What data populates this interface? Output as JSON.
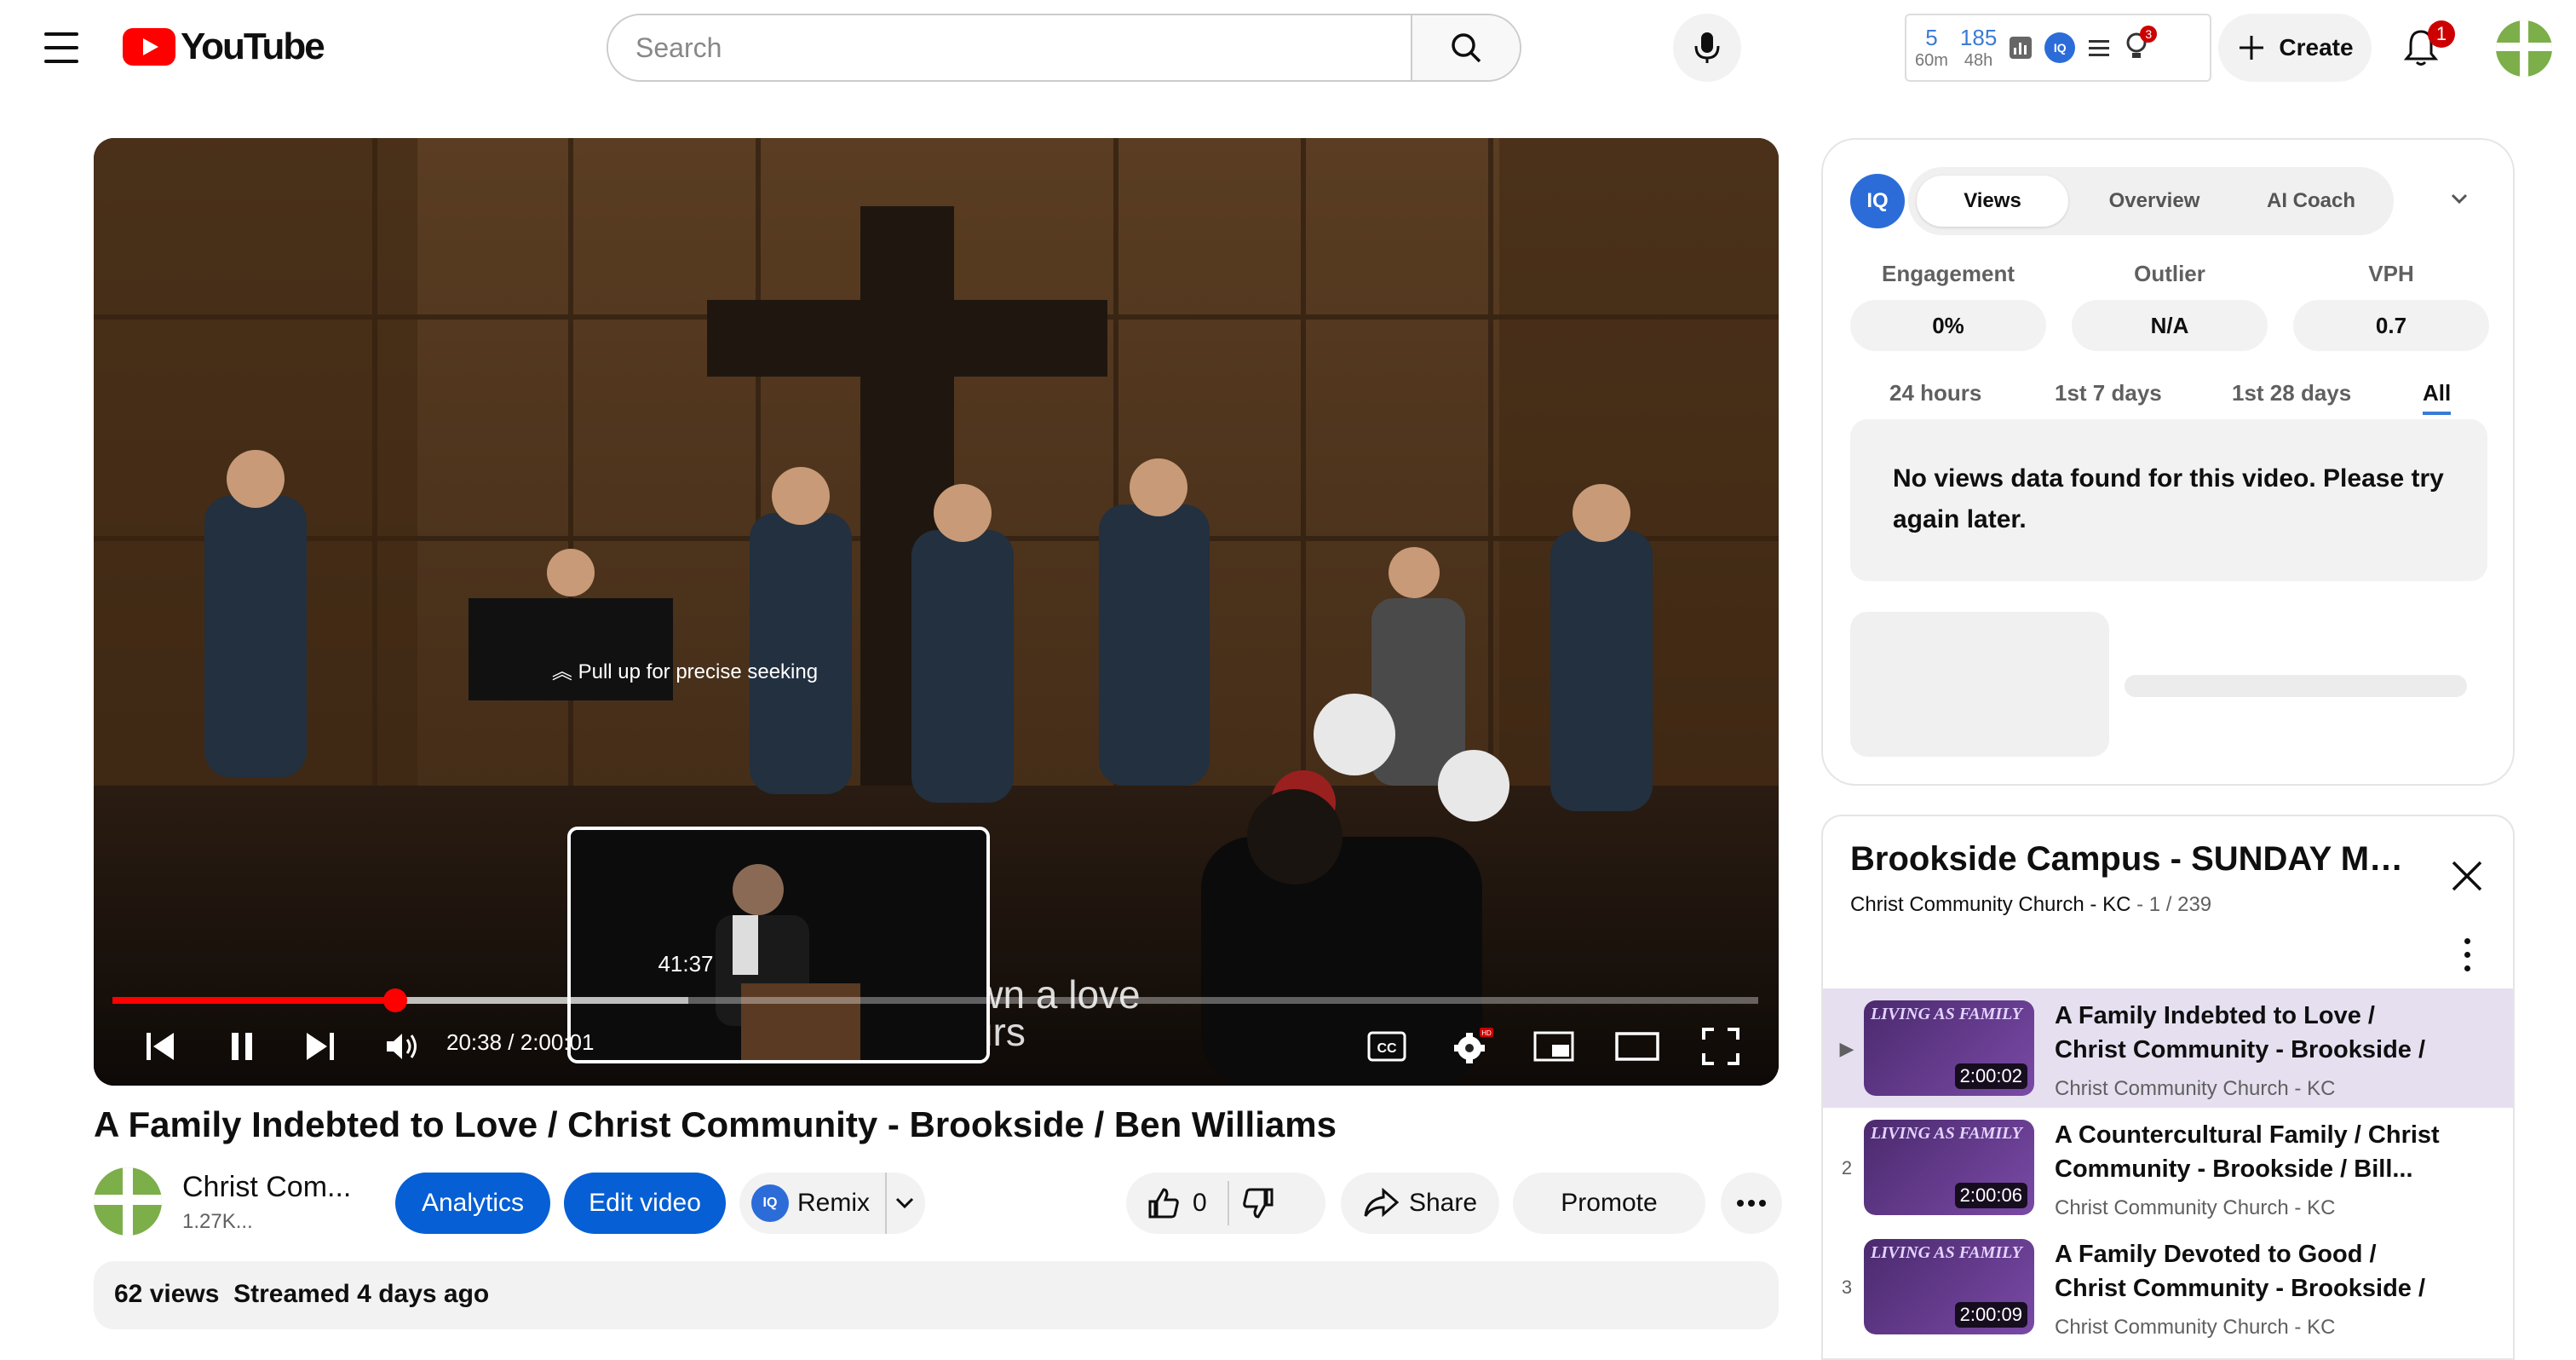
{
  "header": {
    "logo_text": "YouTube",
    "search_placeholder": "Search",
    "ext_stats": [
      {
        "value": "5",
        "label": "60m"
      },
      {
        "value": "185",
        "label": "48h"
      }
    ],
    "ext_badge": "3",
    "create_label": "Create",
    "notif_count": "1"
  },
  "player": {
    "caption_line1": "I've never known a love",
    "caption_line2": "Like yours",
    "seek_hint": "Pull up for precise seeking",
    "hover_time": "41:37",
    "current_time": "20:38 / 2:00:01",
    "progress_fraction": 0.1718,
    "buffer_fraction": 0.35
  },
  "video": {
    "title": "A Family Indebted to Love / Christ Community - Brookside / Ben Williams",
    "channel_name": "Christ Com...",
    "subscribers": "1.27K...",
    "analytics_label": "Analytics",
    "edit_label": "Edit video",
    "remix_label": "Remix",
    "likes": "0",
    "share_label": "Share",
    "promote_label": "Promote",
    "views": "62 views",
    "streamed": "Streamed 4 days ago"
  },
  "vidiq": {
    "tabs": [
      "Views",
      "Overview",
      "AI Coach"
    ],
    "active_tab": "Views",
    "metrics": [
      {
        "label": "Engagement",
        "value": "0%"
      },
      {
        "label": "Outlier",
        "value": "N/A"
      },
      {
        "label": "VPH",
        "value": "0.7"
      }
    ],
    "ranges": [
      "24 hours",
      "1st 7 days",
      "1st 28 days",
      "All"
    ],
    "active_range": "All",
    "no_data": "No views data found for this video. Please try again later."
  },
  "playlist": {
    "title": "Brookside Campus - SUNDAY Messa...",
    "channel": "Christ Community Church - KC",
    "position": "1 / 239",
    "items": [
      {
        "index": "▶",
        "title": "A Family Indebted to Love / Christ Community - Brookside / Ben...",
        "channel": "Christ Community Church - KC",
        "duration": "2:00:02",
        "brand": "LIVING AS FAMILY"
      },
      {
        "index": "2",
        "title": "A Countercultural Family / Christ Community - Brookside / Bill...",
        "channel": "Christ Community Church - KC",
        "duration": "2:00:06",
        "brand": "LIVING AS FAMILY"
      },
      {
        "index": "3",
        "title": "A Family Devoted to Good / Christ Community - Brookside / Bill...",
        "channel": "Christ Community Church - KC",
        "duration": "2:00:09",
        "brand": "LIVING AS FAMILY"
      }
    ]
  },
  "colors": {
    "accent": "#065fd4",
    "progress": "#ff0000",
    "brand_red": "#ff0000",
    "playlist_active": "#e6dff0"
  }
}
